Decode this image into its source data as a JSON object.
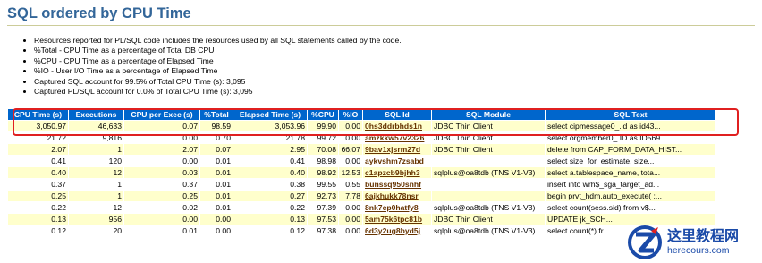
{
  "page": {
    "title": "SQL ordered by CPU Time",
    "notes": [
      "Resources reported for PL/SQL code includes the resources used by all SQL statements called by the code.",
      "%Total - CPU Time as a percentage of Total DB CPU",
      "%CPU - CPU Time as a percentage of Elapsed Time",
      "%IO - User I/O Time as a percentage of Elapsed Time",
      "Captured SQL account for 99.5% of Total CPU Time (s): 3,095",
      "Captured PL/SQL account for 0.0% of Total CPU Time (s): 3,095"
    ]
  },
  "table": {
    "headers": [
      "CPU Time (s)",
      "Executions",
      "CPU per Exec (s)",
      "%Total",
      "Elapsed Time (s)",
      "%CPU",
      "%IO",
      "SQL Id",
      "SQL Module",
      "SQL Text"
    ],
    "rows": [
      [
        "3,050.97",
        "46,633",
        "0.07",
        "98.59",
        "3,053.96",
        "99.90",
        "0.00",
        "0hs3ddrbhds1n",
        "JDBC Thin Client",
        "select cipmessage0_.id as id43..."
      ],
      [
        "21.72",
        "9,816",
        "0.00",
        "0.70",
        "21.78",
        "99.72",
        "0.00",
        "amzkkw57v2326",
        "JDBC Thin Client",
        "select orgmember0_.ID as ID569..."
      ],
      [
        "2.07",
        "1",
        "2.07",
        "0.07",
        "2.95",
        "70.08",
        "66.07",
        "9bav1xjsrm27d",
        "JDBC Thin Client",
        "delete from CAP_FORM_DATA_HIST..."
      ],
      [
        "0.41",
        "120",
        "0.00",
        "0.01",
        "0.41",
        "98.98",
        "0.00",
        "aykvshm7zsabd",
        "",
        "select size_for_estimate, size..."
      ],
      [
        "0.40",
        "12",
        "0.03",
        "0.01",
        "0.40",
        "98.92",
        "12.53",
        "c1apzcb9bjhh3",
        "sqlplus@oa8tdb (TNS V1-V3)",
        "select a.tablespace_name, tota..."
      ],
      [
        "0.37",
        "1",
        "0.37",
        "0.01",
        "0.38",
        "99.55",
        "0.55",
        "bunssq950snhf",
        "",
        "insert into wrh$_sga_target_ad..."
      ],
      [
        "0.25",
        "1",
        "0.25",
        "0.01",
        "0.27",
        "92.73",
        "7.78",
        "6ajkhukk78nsr",
        "",
        "begin prvt_hdm.auto_execute( :..."
      ],
      [
        "0.22",
        "12",
        "0.02",
        "0.01",
        "0.22",
        "97.39",
        "0.00",
        "8nk7cp0hatfy8",
        "sqlplus@oa8tdb (TNS V1-V3)",
        "select count(sess.sid) from v$..."
      ],
      [
        "0.13",
        "956",
        "0.00",
        "0.00",
        "0.13",
        "97.53",
        "0.00",
        "5am75k6tpc81b",
        "JDBC Thin Client",
        "UPDATE jk_SCH..."
      ],
      [
        "0.12",
        "20",
        "0.01",
        "0.00",
        "0.12",
        "97.38",
        "0.00",
        "6d3y2ug8byd5j",
        "sqlplus@oa8tdb (TNS V1-V3)",
        "select count(*) fr..."
      ]
    ],
    "highlighted_row": 0,
    "highlight_color": "#e02020",
    "header_color": "#0066cc",
    "odd_row_color": "#ffffcc"
  },
  "watermark": {
    "cn": "这里教程网",
    "en": "herecours.com"
  }
}
